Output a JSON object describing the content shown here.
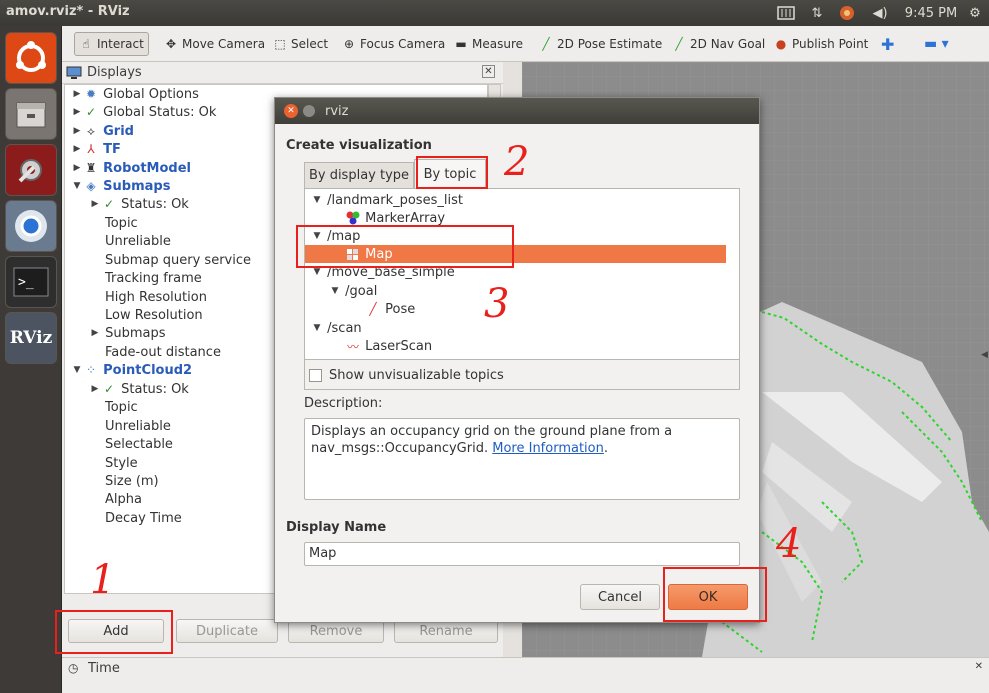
{
  "window_title": "amov.rviz* - RViz",
  "tray": {
    "clock": "9:45 PM",
    "icons": [
      "keyboard-icon",
      "network-icon",
      "update-icon",
      "volume-icon",
      "gear-icon"
    ]
  },
  "launcher": [
    "ubuntu-dash-icon",
    "file-manager-icon",
    "settings-icon",
    "chromium-icon",
    "terminal-icon",
    "rviz-icon"
  ],
  "launcher_rviz_label": "RViz",
  "toolbar": {
    "interact": "Interact",
    "move_camera": "Move Camera",
    "select": "Select",
    "focus_camera": "Focus Camera",
    "measure": "Measure",
    "pose_estimate": "2D Pose Estimate",
    "nav_goal": "2D Nav Goal",
    "publish_point": "Publish Point"
  },
  "displays": {
    "title": "Displays",
    "rows": [
      {
        "label": "Global Options"
      },
      {
        "label": "Global Status: Ok"
      },
      {
        "label": "Grid"
      },
      {
        "label": "TF"
      },
      {
        "label": "RobotModel"
      },
      {
        "label": "Submaps"
      },
      {
        "label": "Status: Ok"
      },
      {
        "label": "Topic"
      },
      {
        "label": "Unreliable"
      },
      {
        "label": "Submap query service"
      },
      {
        "label": "Tracking frame"
      },
      {
        "label": "High Resolution"
      },
      {
        "label": "Low Resolution"
      },
      {
        "label": "Submaps"
      },
      {
        "label": "Fade-out distance"
      },
      {
        "label": "PointCloud2"
      },
      {
        "label": "Status: Ok"
      },
      {
        "label": "Topic"
      },
      {
        "label": "Unreliable"
      },
      {
        "label": "Selectable"
      },
      {
        "label": "Style"
      },
      {
        "label": "Size (m)"
      },
      {
        "label": "Alpha"
      },
      {
        "label": "Decay Time"
      }
    ],
    "buttons": {
      "add": "Add",
      "duplicate": "Duplicate",
      "remove": "Remove",
      "rename": "Rename"
    }
  },
  "time_panel": {
    "title": "Time"
  },
  "dialog": {
    "title": "rviz",
    "heading": "Create visualization",
    "tabs": [
      "By display type",
      "By topic"
    ],
    "topics": [
      {
        "label": "/landmark_poses_list"
      },
      {
        "label": "MarkerArray"
      },
      {
        "label": "/map"
      },
      {
        "label": "Map"
      },
      {
        "label": "/move_base_simple"
      },
      {
        "label": "/goal"
      },
      {
        "label": "Pose"
      },
      {
        "label": "/scan"
      },
      {
        "label": "LaserScan"
      }
    ],
    "show_unvisualizable": "Show unvisualizable topics",
    "description_label": "Description:",
    "description_text": "Displays an occupancy grid on the ground plane from a nav_msgs::OccupancyGrid.",
    "more_info": "More Information",
    "description_end": ".",
    "display_name_label": "Display Name",
    "display_name_value": "Map",
    "cancel": "Cancel",
    "ok": "OK"
  },
  "annotations": [
    "1",
    "2",
    "3",
    "4"
  ],
  "colors": {
    "accent": "#f07746",
    "annotation": "#e8211d",
    "link": "#1f5cc4"
  }
}
